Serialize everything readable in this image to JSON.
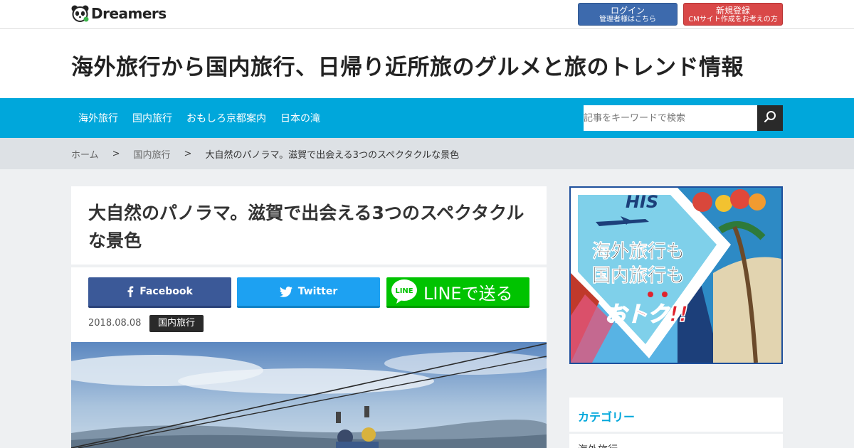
{
  "topbar": {
    "logo_text": "Dreamers",
    "login": {
      "label": "ログイン",
      "sub": "管理者様はこちら"
    },
    "signup": {
      "label": "新規登録",
      "sub": "CMサイト作成をお考えの方"
    }
  },
  "site": {
    "title": "海外旅行から国内旅行、日帰り近所旅のグルメと旅のトレンド情報"
  },
  "nav": {
    "items": [
      "海外旅行",
      "国内旅行",
      "おもしろ京都案内",
      "日本の滝"
    ],
    "search_placeholder": "記事をキーワードで検索"
  },
  "breadcrumb": {
    "home": "ホーム",
    "category": "国内旅行",
    "current": "大自然のパノラマ。滋賀で出会える3つのスペクタクルな景色",
    "separator": ">"
  },
  "article": {
    "title": "大自然のパノラマ。滋賀で出会える3つのスペクタクルな景色",
    "share": {
      "facebook": "Facebook",
      "twitter": "Twitter",
      "line": "LINEで送る",
      "line_logo": "LINE"
    },
    "date": "2018.08.08",
    "category": "国内旅行"
  },
  "ad": {
    "brand": "HIS",
    "line1": "海外旅行も",
    "line2": "国内旅行も",
    "line3": "おトク!!"
  },
  "sidebar": {
    "category_title": "カテゴリー",
    "items": [
      "海外旅行"
    ]
  },
  "colors": {
    "nav": "#00a7db",
    "facebook": "#3b5998",
    "twitter": "#1da1f2",
    "line": "#00c300",
    "login": "#3d6aad",
    "signup": "#d94848"
  }
}
